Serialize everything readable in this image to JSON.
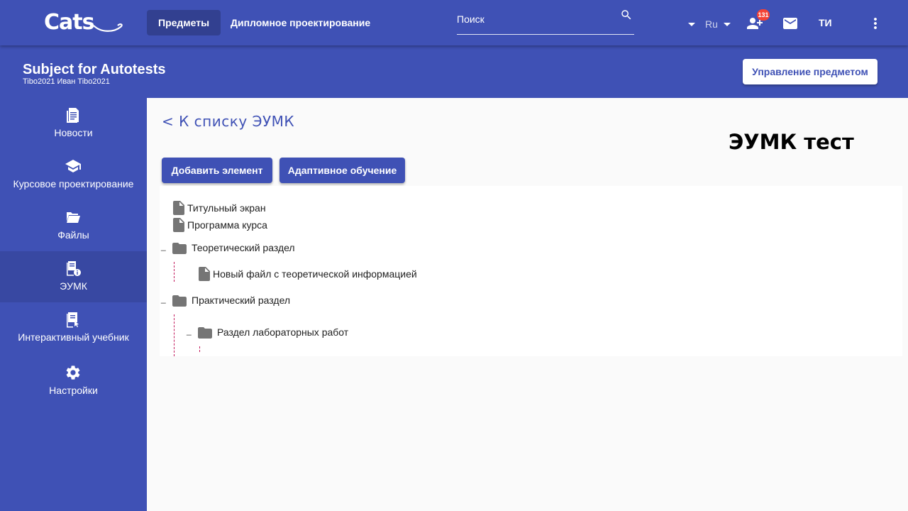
{
  "topbar": {
    "logo_text": "Cats",
    "nav": [
      "Предметы",
      "Дипломное проектирование"
    ],
    "search_placeholder": "Поиск",
    "language": "Ru",
    "notifications_count": "131",
    "user_initials": "ТИ",
    "icons": [
      "search-icon",
      "chevron-down-icon",
      "add-person-icon",
      "mail-icon",
      "more-vertical-icon"
    ]
  },
  "subject": {
    "title": "Subject for Autotests",
    "teacher": "Tibo2021 Иван Tibo2021",
    "manage_label": "Управление предметом"
  },
  "sidebar": {
    "items": [
      {
        "label": "Новости",
        "icon": "news-icon"
      },
      {
        "label": "Курсовое проектирование",
        "icon": "graduation-cap-icon"
      },
      {
        "label": "Файлы",
        "icon": "folder-open-icon"
      },
      {
        "label": "ЭУМК",
        "icon": "book-info-icon"
      },
      {
        "label": "Интерактивный учебник",
        "icon": "book-cursor-icon"
      },
      {
        "label": "Настройки",
        "icon": "gear-icon"
      }
    ],
    "active": "ЭУМК"
  },
  "main": {
    "back_label": "< К списку ЭУМК",
    "title": "ЭУМК тест",
    "add_label": "Добавить элемент",
    "adaptive_label": "Адаптивное обучение",
    "tree": {
      "title_screen": "Титульный экран",
      "program": "Программа курса",
      "theory_section": "Теоретический раздел",
      "theory_file": "Новый файл с теоретической информацией",
      "practice_section": "Практический раздел",
      "labs_section": "Раздел лабораторных работ",
      "toggle": "_"
    }
  },
  "colors": {
    "primary": "#3f51b5",
    "background": "#fafafa",
    "badge": "#f44336",
    "tree_line": "#c2185b",
    "icon_gray": "#757575"
  }
}
